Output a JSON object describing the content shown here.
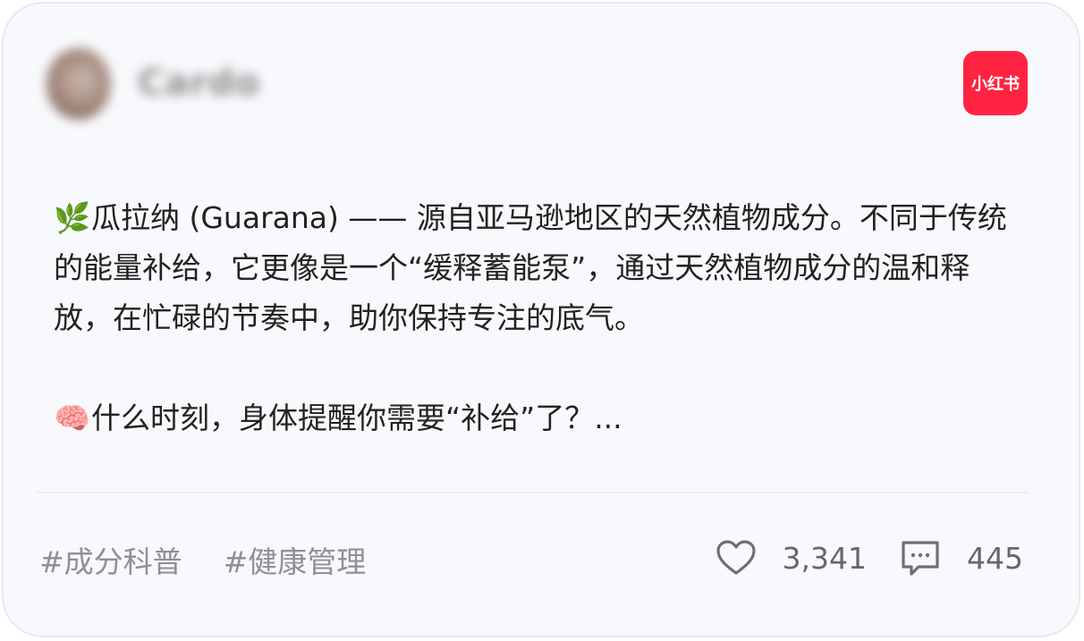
{
  "header": {
    "username": "Cardo",
    "brand_logo_text": "小红书",
    "brand_color": "#ff2442"
  },
  "post": {
    "para1_emoji": "🌿",
    "para1_text": "瓜拉纳 (Guarana) —— 源自亚马逊地区的天然植物成分。不同于传统的能量补给，它更像是一个“缓释蓄能泵”，通过天然植物成分的温和释放，在忙碌的节奏中，助你保持专注的底气。",
    "para2_emoji": "🧠",
    "para2_text": "什么时刻，身体提醒你需要“补给”了？..."
  },
  "footer": {
    "tags": [
      "#成分科普",
      "#健康管理"
    ],
    "like_icon": "heart-icon",
    "like_count": "3,341",
    "comment_icon": "comment-icon",
    "comment_count": "445"
  }
}
